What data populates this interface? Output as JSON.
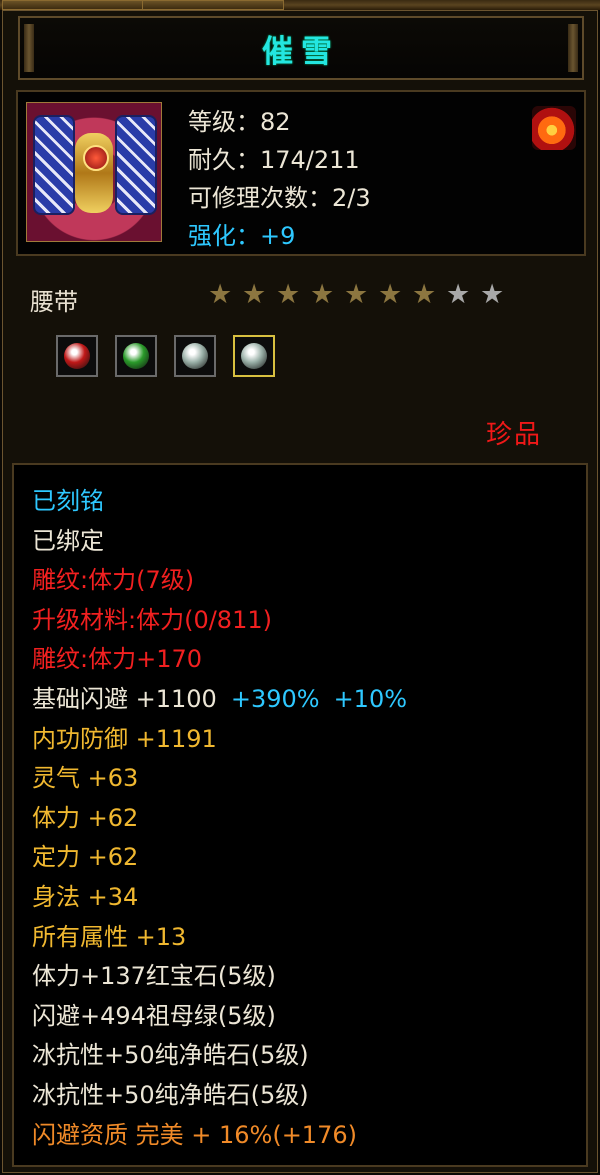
{
  "colors": {
    "title": "#23e6e0",
    "cyan": "#2ec8ff",
    "white": "#ece6d6",
    "red": "#f22020",
    "gold": "#f0b830",
    "orange": "#f08a28",
    "star_on": "#8c7640",
    "star_off": "#a8a8a8"
  },
  "item": {
    "title": "催雪",
    "icon": "belt-item-portrait",
    "stats": [
      {
        "label": "等级：82",
        "color": "white"
      },
      {
        "label": "耐久：174/211",
        "color": "white"
      },
      {
        "label": "可修理次数：2/3",
        "color": "white"
      },
      {
        "label": "强化：+9",
        "color": "cyan"
      }
    ],
    "quality_icon": "fire-icon",
    "type": "腰带",
    "stars_total": 9,
    "stars_lit": 7,
    "gem_slots": [
      {
        "icon": "ruby-gem-icon",
        "color": "#c01818"
      },
      {
        "icon": "emerald-gem-icon",
        "color": "#2a9a2a"
      },
      {
        "icon": "diamond-gem-icon",
        "color": "#9ab0a8"
      },
      {
        "icon": "diamond-gem-icon",
        "color": "#9ab0a8",
        "selected": true
      }
    ],
    "rarity": "珍品"
  },
  "attributes": [
    {
      "parts": [
        {
          "text": "已刻铭",
          "color": "cyan"
        }
      ]
    },
    {
      "parts": [
        {
          "text": "已绑定",
          "color": "white"
        }
      ]
    },
    {
      "parts": [
        {
          "text": "雕纹:体力(7级)",
          "color": "red"
        }
      ]
    },
    {
      "parts": [
        {
          "text": "升级材料:体力(0/811)",
          "color": "red"
        }
      ]
    },
    {
      "parts": [
        {
          "text": "雕纹:体力+170",
          "color": "red"
        }
      ]
    },
    {
      "parts": [
        {
          "text": "基础闪避 +1100",
          "color": "white"
        },
        {
          "text": "+390%",
          "color": "cyan"
        },
        {
          "text": "+10%",
          "color": "cyan"
        }
      ]
    },
    {
      "parts": [
        {
          "text": "内功防御 +1191",
          "color": "gold"
        }
      ]
    },
    {
      "parts": [
        {
          "text": "灵气 +63",
          "color": "gold"
        }
      ]
    },
    {
      "parts": [
        {
          "text": "体力 +62",
          "color": "gold"
        }
      ]
    },
    {
      "parts": [
        {
          "text": "定力 +62",
          "color": "gold"
        }
      ]
    },
    {
      "parts": [
        {
          "text": "身法 +34",
          "color": "gold"
        }
      ]
    },
    {
      "parts": [
        {
          "text": "所有属性 +13",
          "color": "gold"
        }
      ]
    },
    {
      "parts": [
        {
          "text": "体力+137红宝石(5级)",
          "color": "white"
        }
      ]
    },
    {
      "parts": [
        {
          "text": "闪避+494祖母绿(5级)",
          "color": "white"
        }
      ]
    },
    {
      "parts": [
        {
          "text": "冰抗性+50纯净皓石(5级)",
          "color": "white"
        }
      ]
    },
    {
      "parts": [
        {
          "text": "冰抗性+50纯净皓石(5级)",
          "color": "white"
        }
      ]
    },
    {
      "parts": [
        {
          "text": "闪避资质 完美 + 16%(+176)",
          "color": "orange"
        }
      ]
    }
  ]
}
